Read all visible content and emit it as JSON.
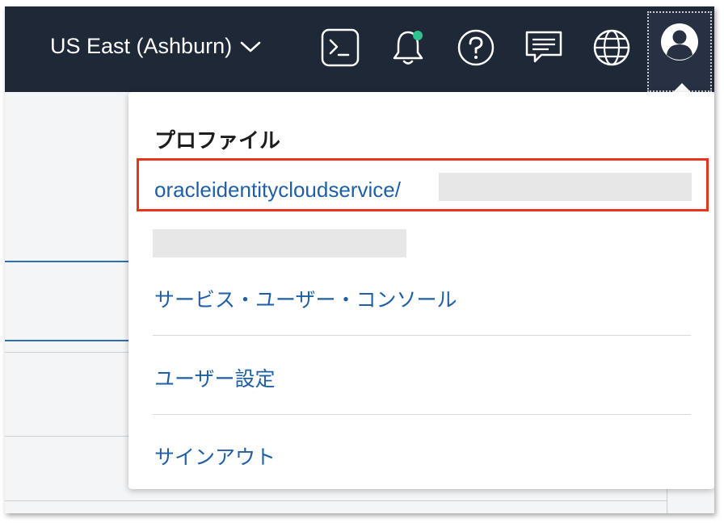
{
  "topbar": {
    "region_label": "US East (Ashburn)",
    "icons": [
      "cloud-shell-icon",
      "bell-icon",
      "help-icon",
      "chat-icon",
      "globe-icon",
      "user-avatar-icon"
    ],
    "notification_dot_color": "#2ec48f"
  },
  "profile_menu": {
    "title": "プロファイル",
    "username": "oracleidentitycloudservice/",
    "items": [
      {
        "label": "サービス・ユーザー・コンソール"
      },
      {
        "label": "ユーザー設定"
      },
      {
        "label": "サインアウト"
      }
    ]
  },
  "colors": {
    "topbar_bg": "#1f2837",
    "link": "#1f5fa6",
    "highlight_border": "#e8341c"
  }
}
